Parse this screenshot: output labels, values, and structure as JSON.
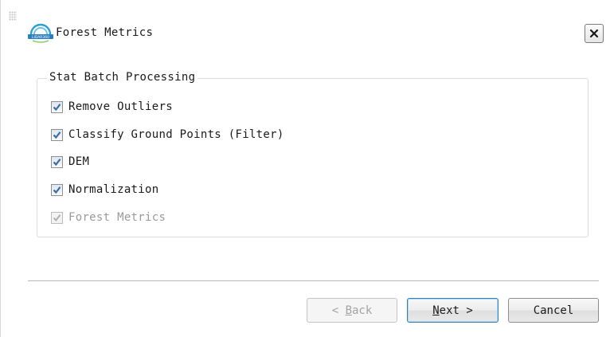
{
  "window": {
    "title": "Forest Metrics",
    "logo_icon": "lidar-logo-icon",
    "close_icon": "close-icon"
  },
  "group": {
    "title": "Stat Batch Processing",
    "options": [
      {
        "label": "Remove Outliers",
        "checked": true,
        "enabled": true
      },
      {
        "label": "Classify Ground Points (Filter)",
        "checked": true,
        "enabled": true
      },
      {
        "label": "DEM",
        "checked": true,
        "enabled": true
      },
      {
        "label": "Normalization",
        "checked": true,
        "enabled": true
      },
      {
        "label": "Forest Metrics",
        "checked": true,
        "enabled": false
      }
    ]
  },
  "buttons": {
    "back": {
      "prefix": "< ",
      "mnemonic": "B",
      "rest": "ack",
      "enabled": false
    },
    "next": {
      "mnemonic": "N",
      "rest": "ext >",
      "enabled": true
    },
    "cancel": {
      "label": "Cancel",
      "enabled": true
    }
  },
  "colors": {
    "checkmark": "#3a6ea5",
    "checkmark_disabled": "#b0b0b0",
    "default_button_border": "#3c7fb1"
  }
}
